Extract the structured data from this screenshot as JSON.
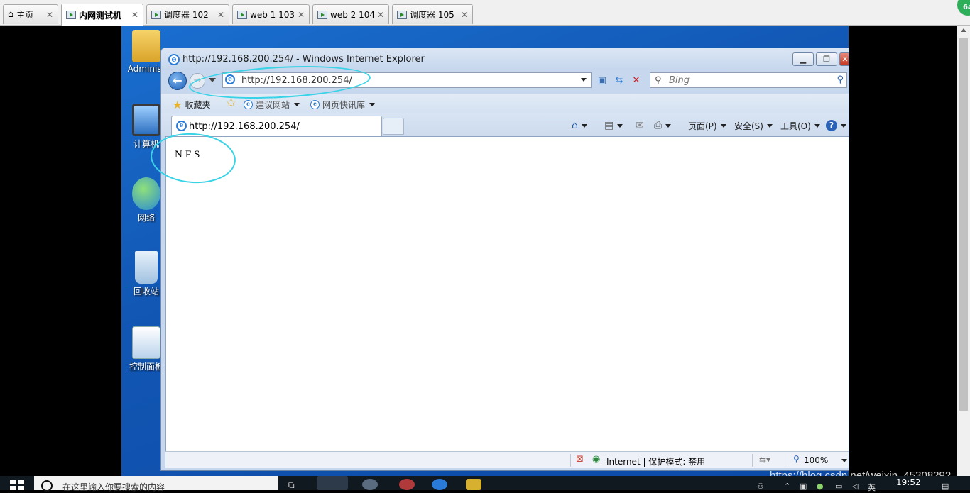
{
  "vm_tabs": [
    {
      "label": "主页",
      "icon": "home-icon",
      "active": false
    },
    {
      "label": "内网测试机",
      "icon": "vm-running-icon",
      "active": true
    },
    {
      "label": "调度器 102",
      "icon": "vm-running-icon",
      "active": false
    },
    {
      "label": "web 1 103",
      "icon": "vm-running-icon",
      "active": false
    },
    {
      "label": "web 2 104",
      "icon": "vm-running-icon",
      "active": false
    },
    {
      "label": "调度器 105",
      "icon": "vm-running-icon",
      "active": false
    }
  ],
  "badge": "64",
  "desktop_icons": [
    "Administ",
    "计算机",
    "网络",
    "回收站",
    "控制面板"
  ],
  "ie": {
    "title": "http://192.168.200.254/ - Windows Internet Explorer",
    "address": "http://192.168.200.254/",
    "search_placeholder": "Bing",
    "favorites": "收藏夹",
    "suggested_sites": "建议网站",
    "web_slice": "网页快讯库",
    "tab_title": "http://192.168.200.254/",
    "menu_page": "页面(P)",
    "menu_safety": "安全(S)",
    "menu_tools": "工具(O)",
    "page_content": "NFS",
    "status_zone": "Internet | 保护模式: 禁用",
    "zoom": "100%"
  },
  "taskbar": {
    "search_placeholder": "在这里输入你要搜索的内容",
    "time": "19:52",
    "ime": "英"
  },
  "watermark": "https://blog.csdn.net/weixin_45308292",
  "colors": {
    "annotation": "#38d3e6",
    "desktop": "#1257b4",
    "badge": "#2fae5a"
  }
}
